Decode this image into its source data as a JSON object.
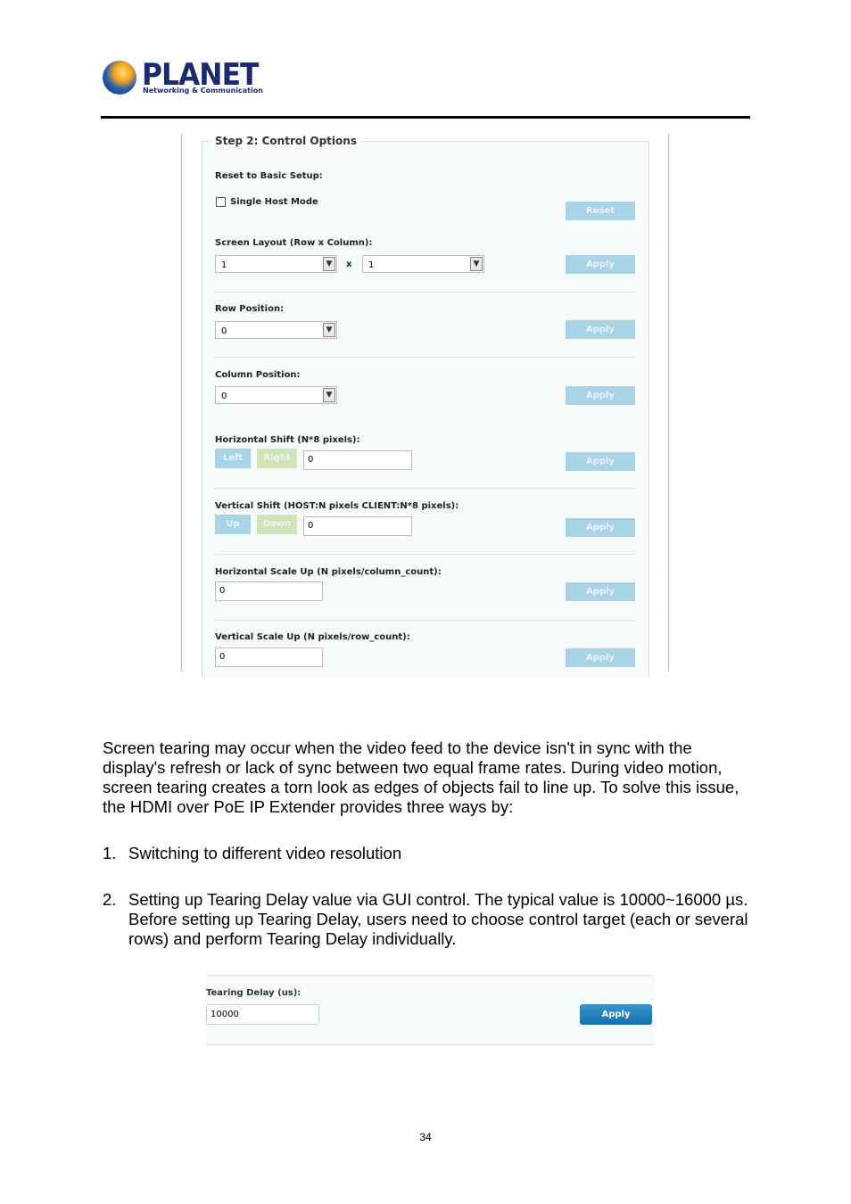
{
  "header": {
    "logo_name": "PLANET",
    "logo_tagline": "Networking & Communication"
  },
  "panel": {
    "legend": "Step 2: Control Options",
    "reset_label": "Reset to Basic Setup:",
    "single_host_label": "Single Host Mode",
    "single_host_checked": false,
    "reset_button": "Reset",
    "layout_label": "Screen Layout (Row x Column):",
    "layout_row": "1",
    "layout_x": "x",
    "layout_col": "1",
    "row_label": "Row Position:",
    "row_value": "0",
    "col_label": "Column Position:",
    "col_value": "0",
    "hshift_label": "Horizontal Shift (N*8 pixels):",
    "left_button": "Left",
    "right_button": "Right",
    "hshift_value": "0",
    "vshift_label": "Vertical Shift (HOST:N pixels CLIENT:N*8 pixels):",
    "up_button": "Up",
    "down_button": "Down",
    "vshift_value": "0",
    "hscale_label": "Horizontal Scale Up (N pixels/column_count):",
    "hscale_value": "0",
    "vscale_label": "Vertical Scale Up (N pixels/row_count):",
    "vscale_value": "0",
    "apply_button": "Apply"
  },
  "text": {
    "paragraph": "Screen tearing may occur when the video feed to the device isn't in sync with the display's refresh or lack of sync between two equal frame rates. During video motion, screen tearing creates a torn look as edges of objects fail to line up. To solve this issue, the HDMI over PoE IP Extender provides three ways by:",
    "items": [
      {
        "num": "1.",
        "text": "Switching to different video resolution"
      },
      {
        "num": "2.",
        "text": "Setting up Tearing Delay value via GUI control. The typical value is 10000~16000 µs. Before setting up Tearing Delay, users need to choose control target (each or several rows) and perform Tearing Delay individually."
      }
    ]
  },
  "tearing": {
    "label": "Tearing Delay (us):",
    "value": "10000",
    "apply_button": "Apply"
  },
  "footer": {
    "page_number": "34"
  },
  "colors": {
    "disabled_button": "#a9d3e6",
    "disabled_green": "#cfe5b8",
    "apply_active": "#1a7ab5",
    "brand": "#1b2a6e"
  }
}
